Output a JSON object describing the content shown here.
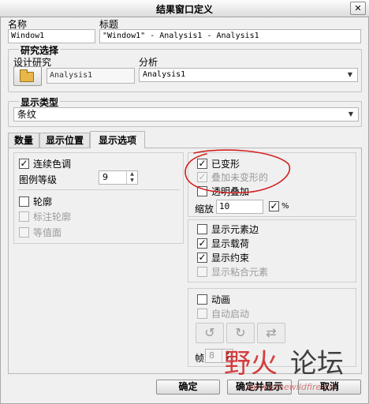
{
  "window": {
    "title": "结果窗口定义",
    "close_glyph": "✕"
  },
  "name": {
    "label": "名称",
    "value": "Window1"
  },
  "title_field": {
    "label": "标题",
    "value": "\"Window1\" - Analysis1 - Analysis1"
  },
  "study": {
    "group_title": "研究选择",
    "design_label": "设计研究",
    "design_value": "Analysis1",
    "analysis_label": "分析",
    "analysis_value": "Analysis1"
  },
  "display_type": {
    "group_title": "显示类型",
    "value": "条纹"
  },
  "tabs": [
    "数量",
    "显示位置",
    "显示选项"
  ],
  "left": {
    "continuous_tone": {
      "label": "连续色调",
      "checked": true
    },
    "legend_level": {
      "label": "图例等级",
      "value": "9"
    },
    "contour": {
      "label": "轮廓",
      "checked": false
    },
    "label_contour": {
      "label": "标注轮廓",
      "checked": false
    },
    "isosurface": {
      "label": "等值面",
      "checked": false
    }
  },
  "right_top": {
    "deformed": {
      "label": "已变形",
      "checked": true
    },
    "overlay_undeformed": {
      "label": "叠加未变形的",
      "checked": true
    },
    "transparent_overlay": {
      "label": "透明叠加",
      "checked": false
    },
    "scale": {
      "label": "缩放",
      "value": "10",
      "percent_checked": true,
      "percent_label": "%"
    }
  },
  "right_mid": {
    "element_edges": {
      "label": "显示元素边",
      "checked": false
    },
    "loads": {
      "label": "显示载荷",
      "checked": true
    },
    "constraints": {
      "label": "显示约束",
      "checked": true
    },
    "bonded_elements": {
      "label": "显示粘合元素",
      "checked": false
    }
  },
  "animation": {
    "animate": {
      "label": "动画",
      "checked": false
    },
    "auto_start": {
      "label": "自动启动",
      "checked": false
    },
    "frames_label": "帧",
    "frames_value": "8"
  },
  "buttons": {
    "ok": "确定",
    "ok_show": "确定并显示",
    "cancel": "取消"
  },
  "watermark": {
    "text_a": "野火",
    "text_b": "论坛",
    "url": "www.proewildfire.cn"
  },
  "colors": {
    "annotation": "#d42020",
    "watermark": "#d12a2a"
  }
}
